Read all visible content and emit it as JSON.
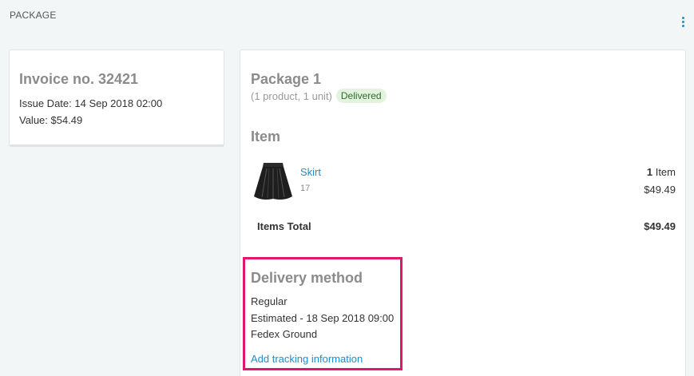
{
  "section": {
    "title": "PACKAGE"
  },
  "invoice": {
    "title": "Invoice no. 32421",
    "issue_date": "Issue Date: 14 Sep 2018 02:00",
    "value": "Value: $54.49"
  },
  "package": {
    "title": "Package 1",
    "summary": "(1 product, 1 unit)",
    "status": "Delivered",
    "items_heading": "Item",
    "items": [
      {
        "name": "Skirt",
        "sku": "17",
        "qty": "1",
        "qty_unit": " Item",
        "price": "$49.49"
      }
    ],
    "total_label": "Items Total",
    "total_value": "$49.49"
  },
  "delivery": {
    "heading": "Delivery method",
    "method": "Regular",
    "estimated": "Estimated - 18 Sep 2018 09:00",
    "carrier": "Fedex Ground",
    "tracking_link": "Add tracking information"
  },
  "colors": {
    "link": "#1a8ed2",
    "highlight": "#e0166f",
    "badge_bg": "#e3f3dd"
  }
}
